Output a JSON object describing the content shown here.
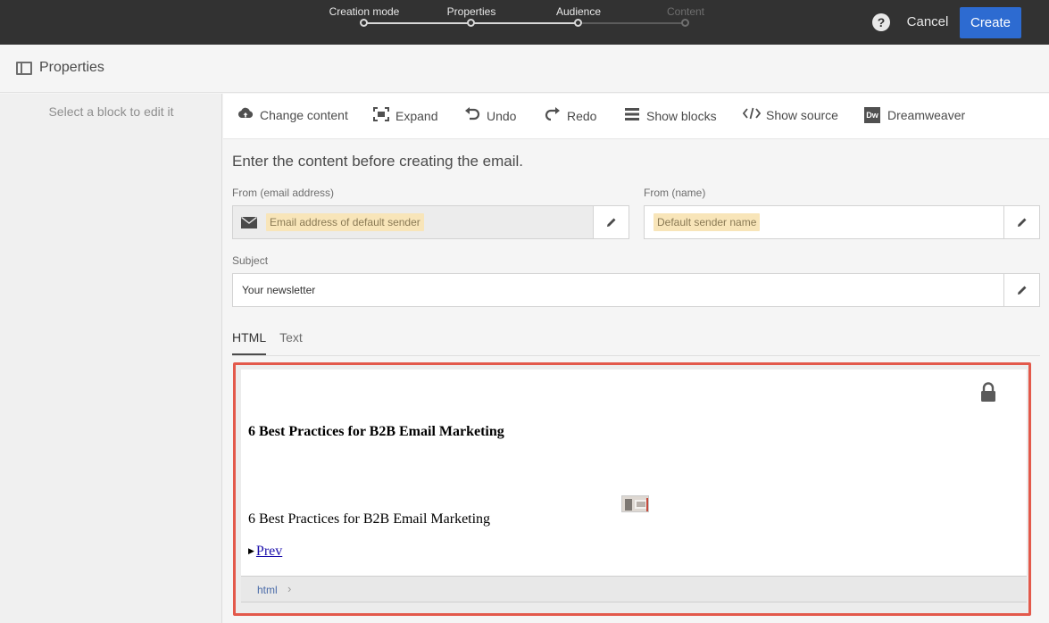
{
  "wizard": {
    "steps": [
      {
        "label": "Creation mode",
        "state": "done"
      },
      {
        "label": "Properties",
        "state": "done"
      },
      {
        "label": "Audience",
        "state": "done"
      },
      {
        "label": "Content",
        "state": "inactive"
      }
    ],
    "help_icon": "?",
    "cancel_label": "Cancel",
    "create_label": "Create",
    "create_color": "#2d6bd1"
  },
  "properties": {
    "title": "Properties",
    "hint": "Select a block to edit it"
  },
  "toolbar": {
    "items": [
      {
        "icon": "cloud-upload-icon",
        "label": "Change content"
      },
      {
        "icon": "expand-icon",
        "label": "Expand"
      },
      {
        "icon": "undo-icon",
        "label": "Undo"
      },
      {
        "icon": "redo-icon",
        "label": "Redo"
      },
      {
        "icon": "blocks-icon",
        "label": "Show blocks"
      },
      {
        "icon": "code-icon",
        "label": "Show source"
      },
      {
        "icon": "dreamweaver-icon",
        "label": "Dreamweaver",
        "icon_text": "Dw"
      }
    ]
  },
  "form": {
    "intro": "Enter the content before creating the email.",
    "from_email_label": "From (email address)",
    "from_email_value": "Email address of default sender",
    "from_name_label": "From (name)",
    "from_name_value": "Default sender name",
    "subject_label": "Subject",
    "subject_value": "Your newsletter"
  },
  "tabs": [
    {
      "label": "HTML",
      "active": true
    },
    {
      "label": "Text",
      "active": false
    }
  ],
  "editor": {
    "heading": "6 Best Practices for B2B Email Marketing",
    "paragraph": "6 Best Practices for B2B Email Marketing",
    "prev_link": "Prev",
    "breadcrumb": "html",
    "highlight_color": "#e3594b"
  }
}
